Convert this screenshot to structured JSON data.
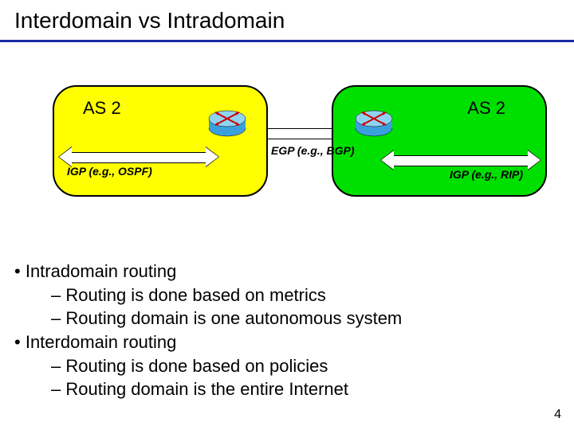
{
  "title": "Interdomain vs Intradomain",
  "diagram": {
    "as_left_label": "AS 2",
    "as_right_label": "AS 2",
    "igp_left": "IGP (e.g., OSPF)",
    "igp_right": "IGP (e.g., RIP)",
    "egp": "EGP (e.g., BGP)"
  },
  "bullets": {
    "intra_heading": "Intradomain routing",
    "intra_1": "Routing is done based on metrics",
    "intra_2": "Routing domain is one autonomous system",
    "inter_heading": "Interdomain routing",
    "inter_1": "Routing is done based on policies",
    "inter_2": "Routing domain is the entire Internet"
  },
  "slide_number": "4"
}
